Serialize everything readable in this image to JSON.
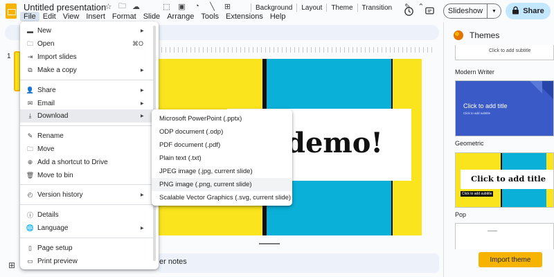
{
  "header": {
    "doc_title": "Untitled presentation",
    "menu": [
      "File",
      "Edit",
      "View",
      "Insert",
      "Format",
      "Slide",
      "Arrange",
      "Tools",
      "Extensions",
      "Help"
    ],
    "slideshow_label": "Slideshow",
    "share_label": "Share"
  },
  "toolbar": {
    "background": "Background",
    "layout": "Layout",
    "theme": "Theme",
    "transition": "Transition"
  },
  "filmstrip": {
    "slide_number": "1"
  },
  "slide": {
    "big_text": "demo!"
  },
  "notes": {
    "text": "er notes"
  },
  "themes": {
    "title": "Themes",
    "subtitle_placeholder": "Click to add subtitle",
    "modern_writer": "Modern Writer",
    "geometric": "Geometric",
    "geometric_title": "Click to add title",
    "geometric_subtitle": "Click to add subtitle",
    "pop": "Pop",
    "pop_title": "Click to add title",
    "pop_subtitle": "Click to add subtitle",
    "import_label": "Import theme"
  },
  "file_menu": {
    "new": "New",
    "open": "Open",
    "open_shortcut": "⌘O",
    "import_slides": "Import slides",
    "make_copy": "Make a copy",
    "share": "Share",
    "email": "Email",
    "download": "Download",
    "rename": "Rename",
    "move": "Move",
    "add_shortcut": "Add a shortcut to Drive",
    "move_to_bin": "Move to bin",
    "version_history": "Version history",
    "details": "Details",
    "language": "Language",
    "page_setup": "Page setup",
    "print_preview": "Print preview"
  },
  "download_menu": [
    "Microsoft PowerPoint (.pptx)",
    "ODP document (.odp)",
    "PDF document (.pdf)",
    "Plain text (.txt)",
    "JPEG image (.jpg, current slide)",
    "PNG image (.png, current slide)",
    "Scalable Vector Graphics (.svg, current slide)"
  ],
  "colors": {
    "slide_yellow": "#fae41d",
    "slide_cyan": "#0ab0d8",
    "share_bg": "#c2e7ff",
    "import_bg": "#f6b400",
    "geometric_blue": "#3a5bc7"
  },
  "icons": [
    "slides-logo-icon",
    "star-icon",
    "folder-icon",
    "cloud-icon",
    "history-icon",
    "comment-icon",
    "lock-icon",
    "grid-icon",
    "palette-icon"
  ]
}
